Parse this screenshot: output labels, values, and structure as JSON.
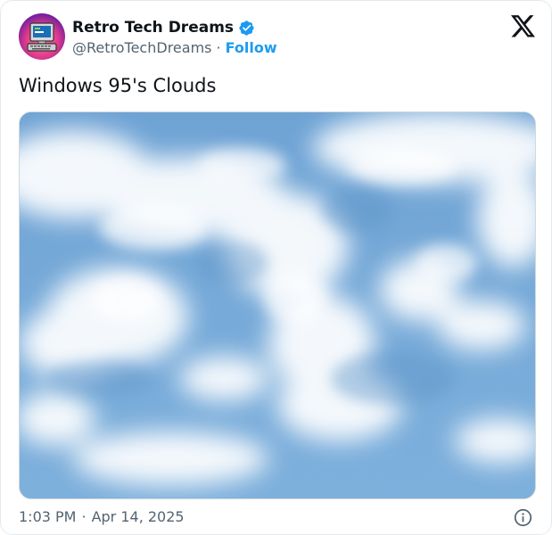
{
  "author": {
    "display_name": "Retro Tech Dreams",
    "handle": "@RetroTechDreams",
    "separator": "·",
    "follow_label": "Follow",
    "verified": true,
    "avatar_icon": "retro-computer-icon"
  },
  "tweet": {
    "text": "Windows 95's Clouds",
    "media_description_icon": "sky-clouds-image"
  },
  "footer": {
    "time": "1:03 PM",
    "separator": "·",
    "date": "Apr 14, 2025",
    "info_icon": "info-icon"
  },
  "brand": {
    "logo_icon": "x-logo-icon",
    "accent_color": "#1d9bf0",
    "text_color": "#0f1419",
    "secondary_text_color": "#536471",
    "sky_color": "#7aa9d6"
  }
}
